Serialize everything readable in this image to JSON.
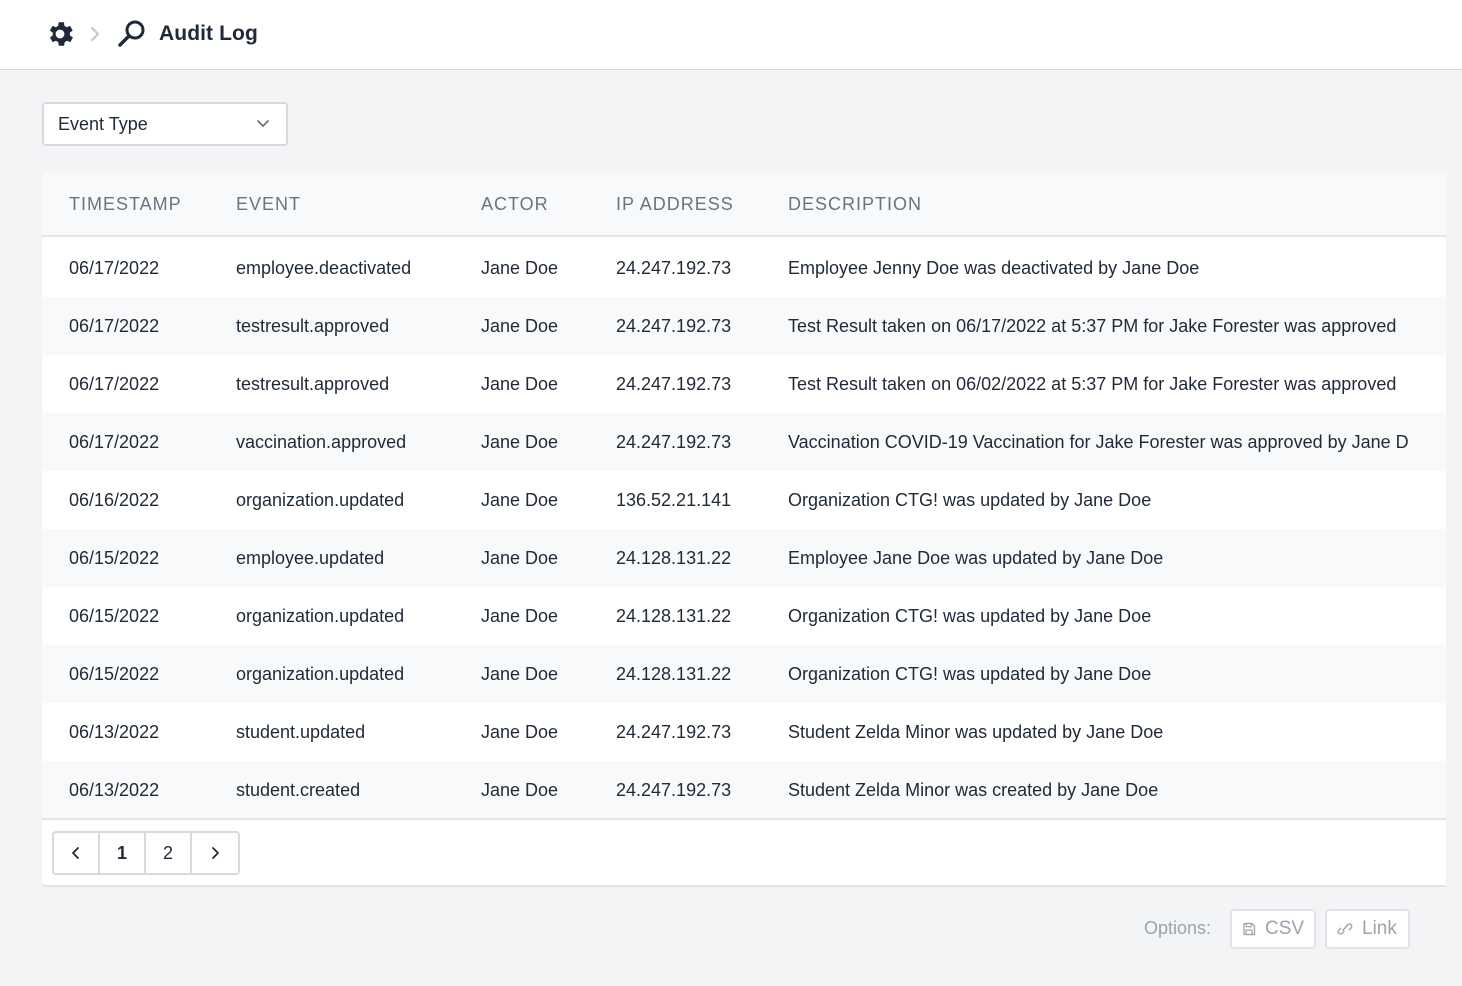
{
  "header": {
    "title": "Audit Log",
    "settings_icon": "gear-icon",
    "separator_icon": "chevron-right-icon",
    "search_icon": "search-icon"
  },
  "filter": {
    "label": "Event Type",
    "icon": "chevron-down-icon"
  },
  "table": {
    "columns": [
      "TIMESTAMP",
      "EVENT",
      "ACTOR",
      "IP ADDRESS",
      "DESCRIPTION"
    ],
    "rows": [
      [
        "06/17/2022",
        "employee.deactivated",
        "Jane Doe",
        "24.247.192.73",
        "Employee Jenny Doe was deactivated by Jane Doe"
      ],
      [
        "06/17/2022",
        "testresult.approved",
        "Jane Doe",
        "24.247.192.73",
        "Test Result taken on 06/17/2022 at 5:37 PM for Jake Forester was approved"
      ],
      [
        "06/17/2022",
        "testresult.approved",
        "Jane Doe",
        "24.247.192.73",
        "Test Result taken on 06/02/2022 at 5:37 PM for Jake Forester was approved"
      ],
      [
        "06/17/2022",
        "vaccination.approved",
        "Jane Doe",
        "24.247.192.73",
        "Vaccination COVID-19 Vaccination for Jake Forester was approved by Jane D"
      ],
      [
        "06/16/2022",
        "organization.updated",
        "Jane Doe",
        "136.52.21.141",
        "Organization CTG! was updated by Jane Doe"
      ],
      [
        "06/15/2022",
        "employee.updated",
        "Jane Doe",
        "24.128.131.22",
        "Employee Jane Doe was updated by Jane Doe"
      ],
      [
        "06/15/2022",
        "organization.updated",
        "Jane Doe",
        "24.128.131.22",
        "Organization CTG! was updated by Jane Doe"
      ],
      [
        "06/15/2022",
        "organization.updated",
        "Jane Doe",
        "24.128.131.22",
        "Organization CTG! was updated by Jane Doe"
      ],
      [
        "06/13/2022",
        "student.updated",
        "Jane Doe",
        "24.247.192.73",
        "Student Zelda Minor was updated by Jane Doe"
      ],
      [
        "06/13/2022",
        "student.created",
        "Jane Doe",
        "24.247.192.73",
        "Student Zelda Minor was created by Jane Doe"
      ]
    ]
  },
  "pagination": {
    "prev_icon": "chevron-left-icon",
    "next_icon": "chevron-right-icon",
    "pages": [
      "1",
      "2"
    ],
    "current": "1"
  },
  "options": {
    "label": "Options:",
    "csv_label": "CSV",
    "csv_icon": "save-icon",
    "link_label": "Link",
    "link_icon": "link-icon"
  },
  "colors": {
    "background": "#f3f4f6",
    "surface": "#ffffff",
    "stripe": "#f8f9fa",
    "text": "#1f2937",
    "muted": "#6b7280",
    "disabled": "#9ca3af"
  }
}
